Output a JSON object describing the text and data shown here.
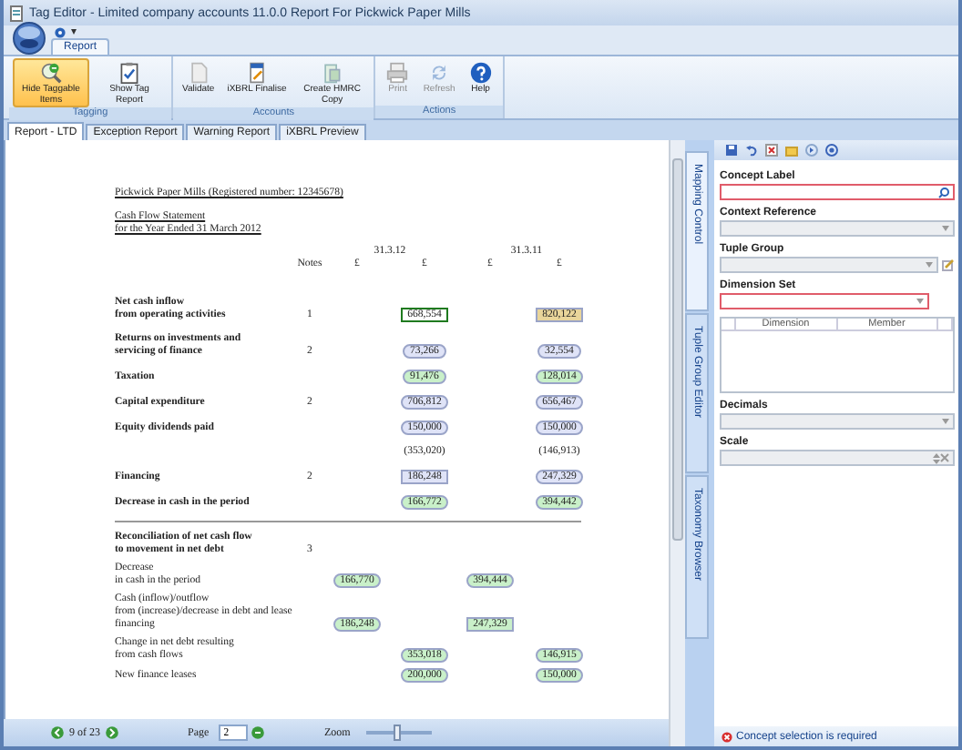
{
  "window": {
    "title": "Tag Editor - Limited company accounts 11.0.0 Report For Pickwick Paper Mills"
  },
  "quick_access": {
    "menu": "▾"
  },
  "ribbon": {
    "tabs": [
      {
        "label": "Report",
        "selected": true
      }
    ],
    "groups": [
      {
        "label": "Tagging",
        "buttons": [
          {
            "label": "Hide Taggable Items",
            "active": true,
            "disabled": false
          },
          {
            "label": "Show Tag Report",
            "active": false,
            "disabled": false
          }
        ]
      },
      {
        "label": "Accounts",
        "buttons": [
          {
            "label": "Validate",
            "active": false,
            "disabled": false
          },
          {
            "label": "iXBRL Finalise",
            "active": false,
            "disabled": false
          },
          {
            "label": "Create HMRC Copy",
            "active": false,
            "disabled": false
          }
        ]
      },
      {
        "label": "Actions",
        "buttons": [
          {
            "label": "Print",
            "active": false,
            "disabled": true
          },
          {
            "label": "Refresh",
            "active": false,
            "disabled": true
          },
          {
            "label": "Help",
            "active": false,
            "disabled": false
          }
        ]
      }
    ]
  },
  "doc_tabs": [
    {
      "label": "Report - LTD",
      "selected": true
    },
    {
      "label": "Exception Report",
      "selected": false
    },
    {
      "label": "Warning Report",
      "selected": false
    },
    {
      "label": "iXBRL Preview",
      "selected": false
    }
  ],
  "document": {
    "company": "Pickwick Paper Mills (Registered number: 12345678)",
    "statement": [
      "Cash Flow Statement",
      "for the Year Ended 31 March 2012"
    ],
    "header": {
      "dates": [
        "31.3.12",
        "31.3.11"
      ],
      "notes": "Notes",
      "currency": [
        "£",
        "£",
        "£",
        "£"
      ]
    },
    "sections": [
      {
        "rows": [
          {
            "label": [
              "Net cash inflow",
              "from operating activities"
            ],
            "bold": true,
            "note": "1",
            "values": {
              "col_b": {
                "text": "668,554",
                "kind": "box",
                "color": "#ffffff",
                "selected": true
              },
              "col_d": {
                "text": "820,122",
                "kind": "box",
                "color": "#e9d59a",
                "selected": false
              }
            }
          },
          {
            "label": [
              "Returns on investments and",
              "servicing of finance"
            ],
            "bold": true,
            "note": "2",
            "values": {
              "col_b": {
                "text": "73,266",
                "kind": "bubble",
                "color": "#dfe3f7",
                "selected": false
              },
              "col_d": {
                "text": "32,554",
                "kind": "bubble",
                "color": "#dfe3f7",
                "selected": false
              }
            }
          },
          {
            "label": [
              "Taxation"
            ],
            "bold": true,
            "values": {
              "col_b": {
                "text": "91,476",
                "kind": "bubble",
                "color": "#c9f0c9",
                "selected": false
              },
              "col_d": {
                "text": "128,014",
                "kind": "bubble",
                "color": "#c9f0c9",
                "selected": false
              }
            }
          },
          {
            "label": [
              "Capital expenditure"
            ],
            "bold": true,
            "note": "2",
            "values": {
              "col_b": {
                "text": "706,812",
                "kind": "bubble",
                "color": "#dfe3f7",
                "selected": false
              },
              "col_d": {
                "text": "656,467",
                "kind": "bubble",
                "color": "#dfe3f7",
                "selected": false
              }
            }
          },
          {
            "label": [
              "Equity dividends paid"
            ],
            "bold": true,
            "values": {
              "col_b": {
                "text": "150,000",
                "kind": "bubble",
                "color": "#dfe3f7",
                "selected": false
              },
              "col_d": {
                "text": "150,000",
                "kind": "bubble",
                "color": "#dfe3f7",
                "selected": false
              }
            }
          },
          {
            "values": {
              "col_b": {
                "text": "(353,020)",
                "kind": "plain"
              },
              "col_d": {
                "text": "(146,913)",
                "kind": "plain"
              }
            }
          },
          {
            "label": [
              "Financing"
            ],
            "bold": true,
            "note": "2",
            "values": {
              "col_b": {
                "text": "186,248",
                "kind": "box",
                "color": "#dfe3f7",
                "selected": false
              },
              "col_d": {
                "text": "247,329",
                "kind": "bubble",
                "color": "#dfe3f7",
                "selected": false
              }
            }
          },
          {
            "label": [
              "Decrease in cash in the period"
            ],
            "bold": true,
            "values": {
              "col_b": {
                "text": "166,772",
                "kind": "bubble",
                "color": "#c9f0c9",
                "selected": false
              },
              "col_d": {
                "text": "394,442",
                "kind": "bubble",
                "color": "#c9f0c9",
                "selected": false
              }
            }
          }
        ]
      },
      {
        "rows": [
          {
            "label": [
              "Reconciliation of net cash flow",
              "to movement in net debt"
            ],
            "bold": true,
            "note": "3"
          },
          {
            "label": [
              "Decrease",
              "in cash in the period"
            ],
            "bold": false,
            "values": {
              "col_a": {
                "text": "166,770",
                "kind": "bubble",
                "color": "#c9f0c9",
                "selected": false
              },
              "col_c": {
                "text": "394,444",
                "kind": "bubble",
                "color": "#c9f0c9",
                "selected": false
              }
            }
          },
          {
            "label": [
              "Cash (inflow)/outflow",
              "from (increase)/decrease in debt and lease",
              "financing"
            ],
            "bold": false,
            "values": {
              "col_a": {
                "text": "186,248",
                "kind": "bubble",
                "color": "#c9f0c9",
                "selected": false
              },
              "col_c": {
                "text": "247,329",
                "kind": "box",
                "color": "#c9f0c9",
                "selected": false
              }
            }
          },
          {
            "label": [
              "Change in net debt resulting",
              "from cash flows"
            ],
            "bold": false,
            "values": {
              "col_b": {
                "text": "353,018",
                "kind": "bubble",
                "color": "#c9f0c9",
                "selected": false
              },
              "col_d": {
                "text": "146,915",
                "kind": "bubble",
                "color": "#c9f0c9",
                "selected": false
              }
            }
          },
          {
            "label": [
              "New finance leases"
            ],
            "bold": false,
            "values": {
              "col_b": {
                "text": "200,000",
                "kind": "bubble",
                "color": "#c9f0c9",
                "selected": false
              },
              "col_d": {
                "text": "150,000",
                "kind": "bubble",
                "color": "#c9f0c9",
                "selected": false
              }
            }
          }
        ]
      }
    ]
  },
  "bottom_bar": {
    "page_count": "9 of 23",
    "page_label": "Page",
    "page": "2",
    "zoom_label": "Zoom",
    "zoom": {
      "level": 0.45
    }
  },
  "side_tabs": [
    {
      "label": "Mapping Control",
      "selected": true
    },
    {
      "label": "Tuple Group Editor",
      "selected": false
    },
    {
      "label": "Taxonomy Browser",
      "selected": false
    }
  ],
  "panel": {
    "fields": [
      {
        "label": "Concept Label",
        "kind": "search",
        "invalid": true,
        "disabled": false
      },
      {
        "label": "Context Reference",
        "kind": "dropdown",
        "invalid": false,
        "disabled": true
      },
      {
        "label": "Tuple Group",
        "kind": "dropdown_edit",
        "invalid": false,
        "disabled": true
      },
      {
        "label": "Dimension Set",
        "kind": "dropdown",
        "invalid": true,
        "disabled": false
      },
      {
        "kind": "grid",
        "columns": [
          "Dimension",
          "Member"
        ]
      },
      {
        "label": "Decimals",
        "kind": "dropdown",
        "invalid": false,
        "disabled": true
      },
      {
        "label": "Scale",
        "kind": "spinner",
        "invalid": false,
        "disabled": true
      }
    ],
    "status": {
      "message": "Concept selection is required"
    }
  }
}
